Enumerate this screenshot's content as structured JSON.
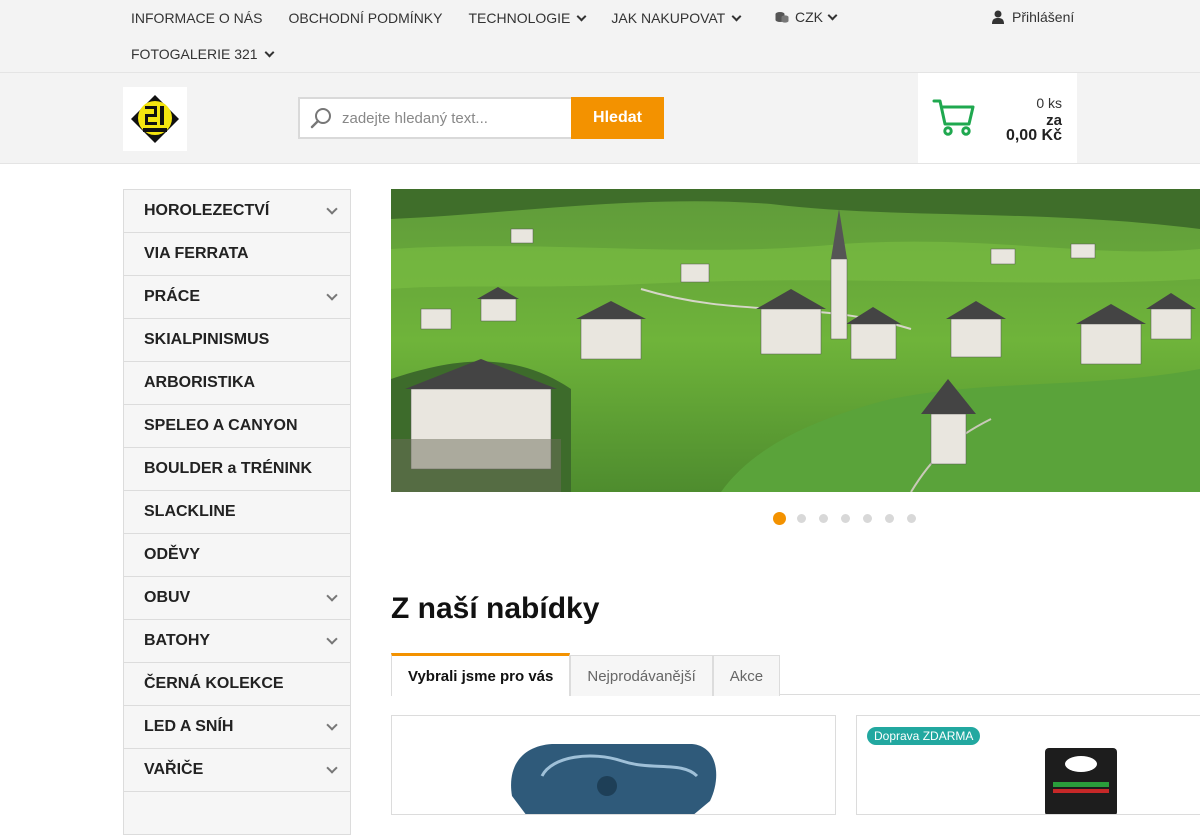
{
  "topnav": {
    "row1": [
      {
        "label": "INFORMACE O NÁS",
        "dropdown": false
      },
      {
        "label": "OBCHODNÍ PODMÍNKY",
        "dropdown": false
      },
      {
        "label": "TECHNOLOGIE",
        "dropdown": true
      },
      {
        "label": "JAK NAKUPOVAT",
        "dropdown": true
      }
    ],
    "row2": [
      {
        "label": "FOTOGALERIE 321",
        "dropdown": true
      }
    ],
    "currency": "CZK",
    "login": "Přihlášení"
  },
  "header": {
    "search_placeholder": "zadejte hledaný text...",
    "search_button": "Hledat",
    "cart": {
      "quantity": "0 ks",
      "za": "za",
      "total": "0,00 Kč"
    }
  },
  "sidebar": {
    "categories": [
      {
        "label": "HOROLEZECTVÍ",
        "dropdown": true
      },
      {
        "label": "VIA FERRATA",
        "dropdown": false
      },
      {
        "label": "PRÁCE",
        "dropdown": true
      },
      {
        "label": "SKIALPINISMUS",
        "dropdown": false
      },
      {
        "label": "ARBORISTIKA",
        "dropdown": false
      },
      {
        "label": "SPELEO A CANYON",
        "dropdown": false
      },
      {
        "label": "BOULDER a TRÉNINK",
        "dropdown": false
      },
      {
        "label": "SLACKLINE",
        "dropdown": false
      },
      {
        "label": "ODĚVY",
        "dropdown": false
      },
      {
        "label": "OBUV",
        "dropdown": true
      },
      {
        "label": "BATOHY",
        "dropdown": true
      },
      {
        "label": "ČERNÁ KOLEKCE",
        "dropdown": false
      },
      {
        "label": "LED A SNÍH",
        "dropdown": true
      },
      {
        "label": "VAŘIČE",
        "dropdown": true
      }
    ]
  },
  "slider": {
    "total_slides": 7,
    "active_index": 0
  },
  "offer": {
    "title": "Z naší nabídky",
    "tabs": [
      "Vybrali jsme pro vás",
      "Nejprodávanější",
      "Akce"
    ],
    "products": [
      {
        "badge": ""
      },
      {
        "badge": "Doprava ZDARMA"
      }
    ]
  },
  "colors": {
    "accent": "#f39200",
    "cart_icon": "#1fa84f",
    "badge": "#22a8a0"
  }
}
